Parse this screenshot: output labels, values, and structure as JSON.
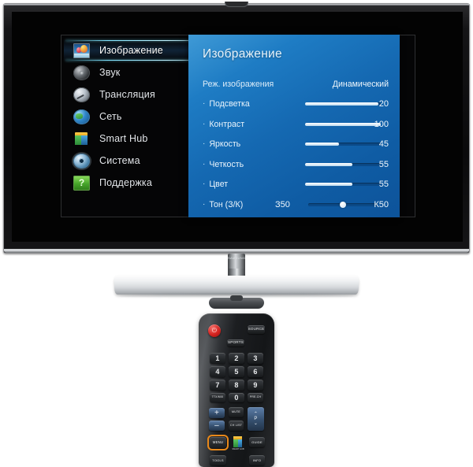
{
  "device": {
    "brand": "SAMSUNG",
    "type": "smart-tv-with-remote",
    "background_color": "#ffffff",
    "bezel_color": "#121214",
    "stand_color": "#d5d8db"
  },
  "osd": {
    "sidebar": {
      "items": [
        {
          "label": "Изображение",
          "icon": "picture-icon",
          "selected": true
        },
        {
          "label": "Звук",
          "icon": "speaker-icon",
          "selected": false
        },
        {
          "label": "Трансляция",
          "icon": "broadcast-icon",
          "selected": false
        },
        {
          "label": "Сеть",
          "icon": "globe-icon",
          "selected": false
        },
        {
          "label": "Smart Hub",
          "icon": "cube-icon",
          "selected": false
        },
        {
          "label": "Система",
          "icon": "gear-icon",
          "selected": false
        },
        {
          "label": "Поддержка",
          "icon": "help-icon",
          "selected": false
        }
      ],
      "highlight_color": "#7fe4ff"
    },
    "panel": {
      "title": "Изображение",
      "accent_color": "#1569b2",
      "mode_row": {
        "label": "Реж. изображения",
        "value": "Динамический"
      },
      "settings": [
        {
          "bullet": "·",
          "label": "Подсветка",
          "value": "20",
          "percent": 97
        },
        {
          "bullet": "·",
          "label": "Контраст",
          "value": "100",
          "percent": 100
        },
        {
          "bullet": "·",
          "label": "Яркость",
          "value": "45",
          "percent": 45
        },
        {
          "bullet": "·",
          "label": "Четкость",
          "value": "55",
          "percent": 62
        },
        {
          "bullet": "·",
          "label": "Цвет",
          "value": "55",
          "percent": 62
        }
      ],
      "tint_row": {
        "bullet": "·",
        "label": "Тон (З/К)",
        "left_value": "З50",
        "right_value": "К50",
        "knob_percent": 50
      }
    }
  },
  "remote": {
    "power_label": "⏻",
    "source_label": "SOURCE",
    "sports_label": "SPORTS",
    "keypad": [
      "1",
      "2",
      "3",
      "4",
      "5",
      "6",
      "7",
      "8",
      "9"
    ],
    "keypad_bottom": [
      "TTX/MIX",
      "0",
      "PRE-CH"
    ],
    "volume_up": "+",
    "volume_down": "–",
    "mute_label": "MUTE",
    "chlist_label": "CH LIST",
    "channel_label": "P",
    "channel_up": "⌃",
    "channel_down": "⌄",
    "menu_label": "MENU",
    "smarthub_label": "SMART HUB",
    "guide_label": "GUIDE",
    "tools_label": "TOOLS",
    "info_label": "INFO",
    "menu_highlight_color": "#e8881a"
  }
}
